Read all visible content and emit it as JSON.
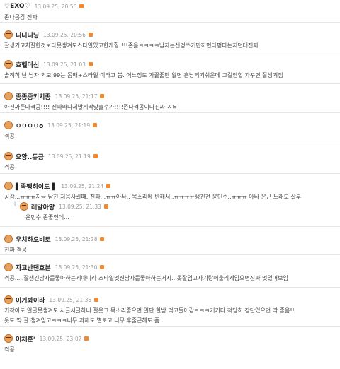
{
  "comments": [
    {
      "name": "♡EXO♡",
      "date": "13.09.25, 20:56",
      "lines": [
        "존나공감 진짜"
      ]
    },
    {
      "name": "니니니닝",
      "date": "13.09.25, 20:56",
      "lines": [
        "잘생기고치질한것보다못생겨도스타일있고한게훨!!!!존음ㅋㅋㅋㅋ남자는신경쓰기만하면다평타는치던데진짜"
      ]
    },
    {
      "name": "흐헬머신",
      "date": "13.09.25, 21:03",
      "lines": [
        "솔직히 난 남자 외모 99는 몸매+스타일 이라고 봄. 어느정도 가꿀줄만 알면 훈남되기쉬운데 그걸안할 가꾸면 잘생겨짐"
      ]
    },
    {
      "name": "종종종키치종",
      "date": "13.09.25, 21:17",
      "lines": [
        "아진짜존나격공!!!! 진짜와나제발게딱맞출수가!!!!존나격공이다진짜 ㅅㅂ"
      ]
    },
    {
      "name": "ㅇㅇㅇㅇo",
      "date": "13.09.25, 21:19",
      "lines": [
        "격공"
      ]
    },
    {
      "name": "으앙..듀금",
      "date": "13.09.25, 21:19",
      "lines": [
        "격공"
      ]
    },
    {
      "name": "▌족쨍히이도 ▌",
      "date": "13.09.25, 21:24",
      "lines": [
        "공감...ㅠㅠㅠ지금 남친 처음사귈때..진짜...ㅠㅠ아놔.. 목소리에 반해서..ㅠㅠㅠㅠ생긴건 윤민수..ㅠㅠㅠ 아놔 은근 노래도 잘부"
      ]
    },
    {
      "name": "레알아양",
      "date": "13.09.25, 21:33",
      "lines": [
        "윤민수 존좋인데..."
      ],
      "reply": true
    },
    {
      "name": "우치하오비토",
      "date": "13.09.25, 21:28",
      "lines": [
        "진짜 격공"
      ]
    },
    {
      "name": "자고반댄호븐",
      "date": "13.09.25, 21:30",
      "lines": [
        "격공.....잘생긴남자를좋아하는게아니라 스타일멋진남자를좋아하는거지...옷잘입고자기랑어울리게입으면진짜 멋있어보임"
      ]
    },
    {
      "name": "이거봐이라",
      "date": "13.09.25, 21:35",
      "lines": [
        "키작아도 얼굴못생겨도 서글서글하니 잘웃고 목소리좋으면 일단 한방 먹고들어감ㅋㅋㅋ거기다 적당히 강단있으면 딱 좋음!!",
        "옷도 딱 잘 챙겨입고ㅋㅋㅋ너무 과해도 별로고 너무 후줄근해도 좀.."
      ]
    },
    {
      "name": "이채훈'",
      "date": "13.09.25, 23:07",
      "lines": [
        "격공"
      ]
    }
  ]
}
